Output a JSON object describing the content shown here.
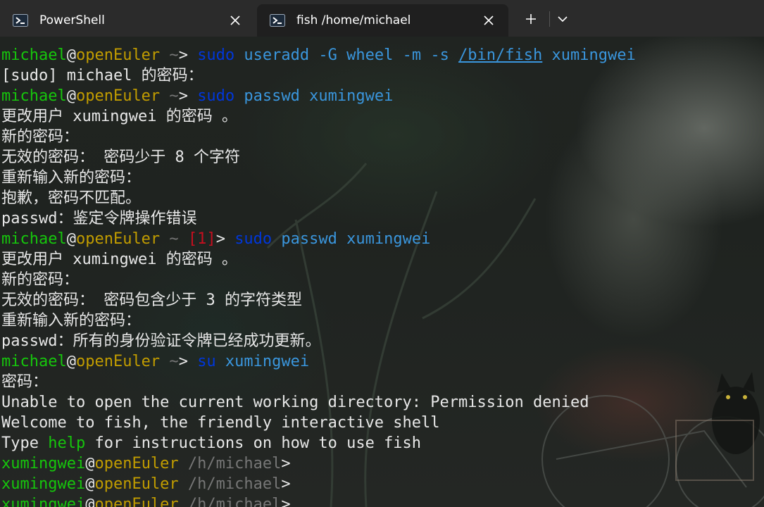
{
  "tabs": [
    {
      "title": "PowerShell",
      "icon": "powershell-icon"
    },
    {
      "title": "fish /home/michael",
      "icon": "powershell-icon",
      "active": true
    }
  ],
  "toolbar": {
    "new_tab": "+",
    "dropdown": "chevron-down-icon"
  },
  "colors": {
    "user": "#16c60c",
    "at": "#e8e8e8",
    "host": "#c19c00",
    "path": "#767676",
    "status": "#c50f1f",
    "command": "#0037da",
    "argument": "#3a96dd",
    "text": "#e8e8e8"
  },
  "terminal": {
    "lines": [
      {
        "type": "prompt",
        "user": "michael",
        "at": "@",
        "host": "openEuler",
        "path": " ~",
        "status": "",
        "end": "> ",
        "cmd": "sudo",
        "args": [
          {
            "t": " useradd -G wheel -m -s "
          },
          {
            "t": "/bin/fish",
            "link": true
          },
          {
            "t": " xumingwei"
          }
        ]
      },
      {
        "type": "text",
        "text": "[sudo] michael 的密码："
      },
      {
        "type": "prompt",
        "user": "michael",
        "at": "@",
        "host": "openEuler",
        "path": " ~",
        "status": "",
        "end": "> ",
        "cmd": "sudo",
        "args": [
          {
            "t": " passwd xumingwei"
          }
        ]
      },
      {
        "type": "text",
        "text": "更改用户 xumingwei 的密码 。"
      },
      {
        "type": "text",
        "text": "新的密码："
      },
      {
        "type": "text",
        "text": "无效的密码： 密码少于 8 个字符"
      },
      {
        "type": "text",
        "text": "重新输入新的密码："
      },
      {
        "type": "text",
        "text": "抱歉，密码不匹配。"
      },
      {
        "type": "text",
        "text": "passwd：鉴定令牌操作错误"
      },
      {
        "type": "prompt",
        "user": "michael",
        "at": "@",
        "host": "openEuler",
        "path": " ~ ",
        "status": "[1]",
        "end": "> ",
        "cmd": "sudo",
        "args": [
          {
            "t": " passwd xumingwei"
          }
        ]
      },
      {
        "type": "text",
        "text": "更改用户 xumingwei 的密码 。"
      },
      {
        "type": "text",
        "text": "新的密码："
      },
      {
        "type": "text",
        "text": "无效的密码： 密码包含少于 3 的字符类型"
      },
      {
        "type": "text",
        "text": "重新输入新的密码："
      },
      {
        "type": "text",
        "text": "passwd：所有的身份验证令牌已经成功更新。"
      },
      {
        "type": "prompt",
        "user": "michael",
        "at": "@",
        "host": "openEuler",
        "path": " ~",
        "status": "",
        "end": "> ",
        "cmd": "su",
        "args": [
          {
            "t": " xumingwei"
          }
        ]
      },
      {
        "type": "text",
        "text": "密码："
      },
      {
        "type": "text",
        "text": "Unable to open the current working directory: Permission denied"
      },
      {
        "type": "text",
        "text": "Welcome to fish, the friendly interactive shell"
      },
      {
        "type": "help",
        "pre": "Type ",
        "kw": "help",
        "post": " for instructions on how to use fish"
      },
      {
        "type": "prompt",
        "user": "xumingwei",
        "at": "@",
        "host": "openEuler",
        "path": " /h/michael",
        "status": "",
        "end": ">",
        "cmd": "",
        "args": []
      },
      {
        "type": "prompt",
        "user": "xumingwei",
        "at": "@",
        "host": "openEuler",
        "path": " /h/michael",
        "status": "",
        "end": ">",
        "cmd": "",
        "args": []
      },
      {
        "type": "prompt",
        "user": "xumingwei",
        "at": "@",
        "host": "openEuler",
        "path": " /h/michael",
        "status": "",
        "end": ">",
        "cmd": "",
        "args": []
      }
    ]
  }
}
